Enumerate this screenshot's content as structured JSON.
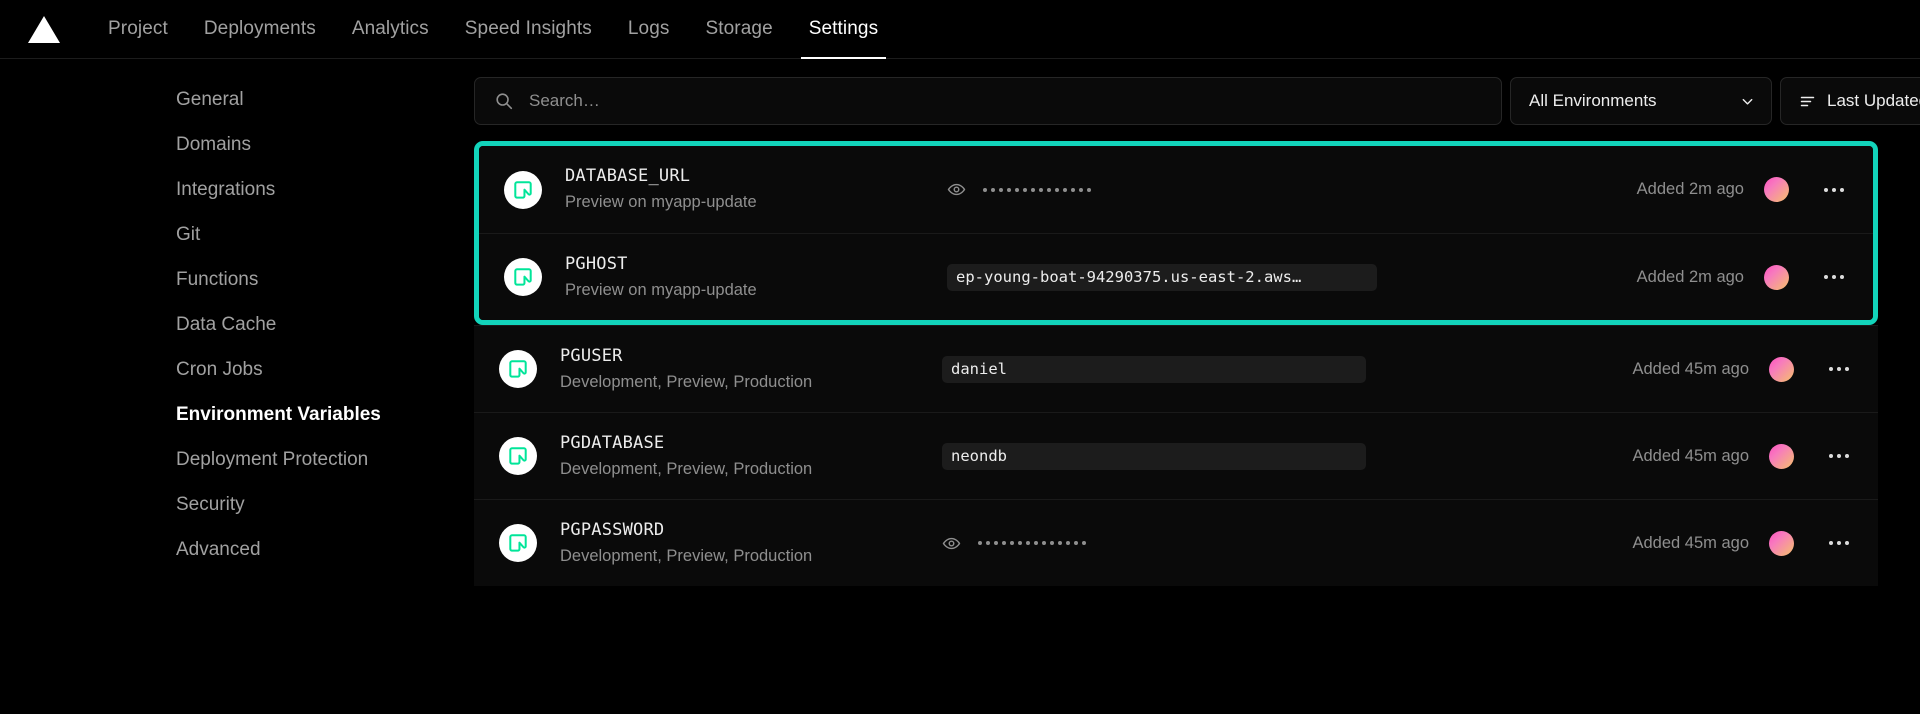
{
  "topnav": {
    "logo": "vercel-triangle-logo",
    "items": [
      {
        "label": "Project",
        "active": false
      },
      {
        "label": "Deployments",
        "active": false
      },
      {
        "label": "Analytics",
        "active": false
      },
      {
        "label": "Speed Insights",
        "active": false
      },
      {
        "label": "Logs",
        "active": false
      },
      {
        "label": "Storage",
        "active": false
      },
      {
        "label": "Settings",
        "active": true
      }
    ]
  },
  "sidebar": {
    "items": [
      {
        "label": "General"
      },
      {
        "label": "Domains"
      },
      {
        "label": "Integrations"
      },
      {
        "label": "Git"
      },
      {
        "label": "Functions"
      },
      {
        "label": "Data Cache"
      },
      {
        "label": "Cron Jobs"
      },
      {
        "label": "Environment Variables"
      },
      {
        "label": "Deployment Protection"
      },
      {
        "label": "Security"
      },
      {
        "label": "Advanced"
      }
    ],
    "active_label": "Environment Variables"
  },
  "toolbar": {
    "search": {
      "value": "",
      "placeholder": "Search…",
      "icon": "search-icon"
    },
    "environment_filter": {
      "selected": "All Environments",
      "icon": "chevron-down-icon"
    },
    "sort_filter": {
      "selected": "Last Updated",
      "icon": "sort-icon"
    }
  },
  "colors": {
    "highlight": "#12d4bb",
    "accent_brand": "#00e599",
    "panel": "#0a0a0a",
    "text_primary": "#ededed",
    "text_muted": "#8f8f8f"
  },
  "env_vars": {
    "highlighted_keys": [
      "DATABASE_URL",
      "PGHOST"
    ],
    "rows": [
      {
        "key": "DATABASE_URL",
        "environments": "Preview on myapp-update",
        "value_type": "secret",
        "value": "",
        "secret_dots": 14,
        "added": "Added 2m ago",
        "icon": "neon-logo-icon",
        "highlighted": true
      },
      {
        "key": "PGHOST",
        "environments": "Preview on myapp-update",
        "value_type": "text",
        "value": "ep-young-boat-94290375.us-east-2.aws…",
        "added": "Added 2m ago",
        "icon": "neon-logo-icon",
        "highlighted": true
      },
      {
        "key": "PGUSER",
        "environments": "Development, Preview, Production",
        "value_type": "text",
        "value": "daniel",
        "added": "Added 45m ago",
        "icon": "neon-logo-icon",
        "highlighted": false
      },
      {
        "key": "PGDATABASE",
        "environments": "Development, Preview, Production",
        "value_type": "text",
        "value": "neondb",
        "added": "Added 45m ago",
        "icon": "neon-logo-icon",
        "highlighted": false
      },
      {
        "key": "PGPASSWORD",
        "environments": "Development, Preview, Production",
        "value_type": "secret",
        "value": "",
        "secret_dots": 14,
        "added": "Added 45m ago",
        "icon": "neon-logo-icon",
        "highlighted": false
      }
    ]
  }
}
